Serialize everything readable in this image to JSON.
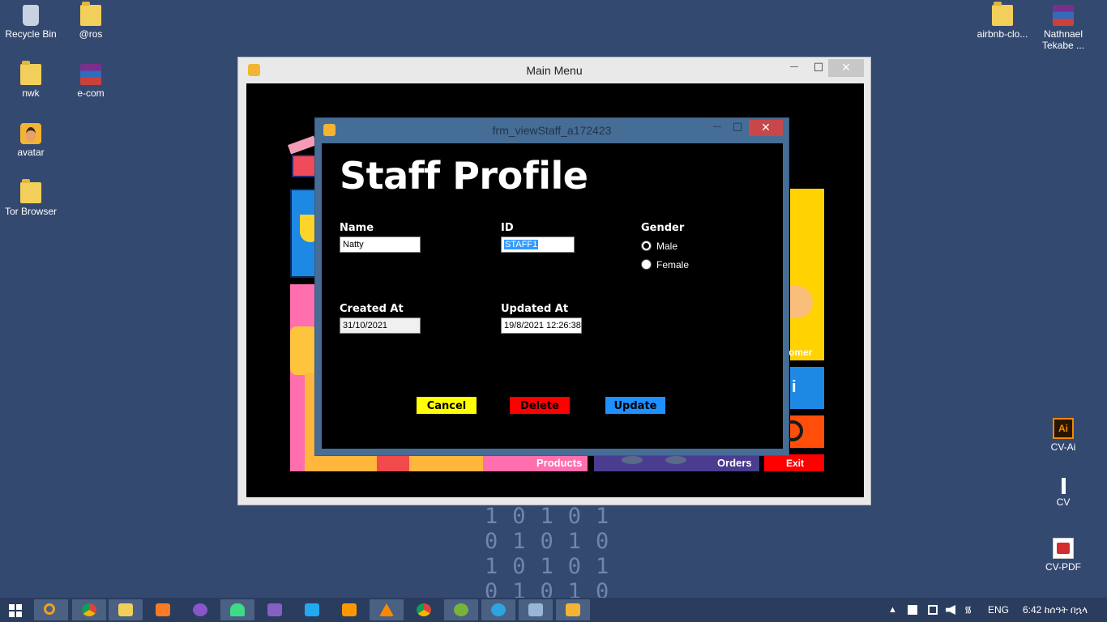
{
  "desktop": {
    "icons": [
      {
        "label": "Recycle Bin",
        "icon": "recycle-bin-icon"
      },
      {
        "label": "@ros",
        "icon": "folder-icon"
      },
      {
        "label": "nwk",
        "icon": "folder-icon"
      },
      {
        "label": "e-com",
        "icon": "archive-icon"
      },
      {
        "label": "avatar",
        "icon": "avatar-image-icon"
      },
      {
        "label": "Tor Browser",
        "icon": "folder-icon"
      },
      {
        "label": "airbnb-clo...",
        "icon": "folder-icon"
      },
      {
        "label": "Nathnael Tekabe ...",
        "icon": "archive-icon"
      },
      {
        "label": "CV-Ai",
        "icon": "illustrator-file-icon",
        "glyph": "Ai"
      },
      {
        "label": "CV",
        "icon": "file-icon"
      },
      {
        "label": "CV-PDF",
        "icon": "pdf-file-icon"
      }
    ],
    "binary_rows": [
      "10101",
      "01010",
      "10101",
      "01010"
    ]
  },
  "main_window": {
    "title": "Main Menu",
    "minimize": "—",
    "maximize": "☐",
    "close": "✕",
    "tiles": {
      "products": "Products",
      "orders": "Orders",
      "exit": "Exit",
      "customer": "omer"
    }
  },
  "dialog": {
    "title": "frm_viewStaff_a172423",
    "minimize": "—",
    "maximize": "☐",
    "close": "✕",
    "heading": "Staff Profile",
    "fields": {
      "name_label": "Name",
      "name_value": "Natty",
      "id_label": "ID",
      "id_value": "STAFF1",
      "gender_label": "Gender",
      "gender_options": [
        "Male",
        "Female"
      ],
      "gender_selected": "Male",
      "created_label": "Created At",
      "created_value": "31/10/2021",
      "updated_label": "Updated At",
      "updated_value": "19/8/2021 12:26:38"
    },
    "buttons": {
      "cancel": "Cancel",
      "delete": "Delete",
      "update": "Update"
    },
    "colors": {
      "cancel": "#ffff00",
      "delete": "#ff0000",
      "update": "#1e90ff"
    }
  },
  "taskbar": {
    "apps": [
      "windows-start",
      "search",
      "chrome",
      "file-explorer",
      "xampp",
      "github-desktop",
      "android-studio",
      "visual-studio",
      "vscode",
      "sublime-text",
      "vlc",
      "chrome-alt",
      "utorrent",
      "telegram",
      "remote-desktop",
      "avatar-app"
    ],
    "lang": "ENG",
    "clock": "6:42 ከሰዓት በኋላ"
  }
}
